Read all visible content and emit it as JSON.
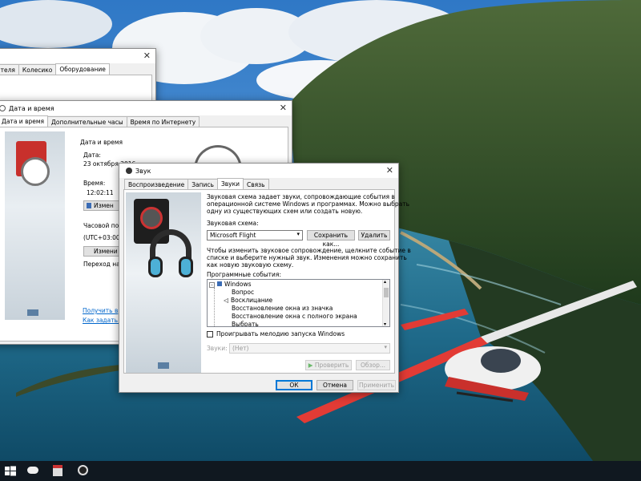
{
  "window1": {
    "tabs": [
      "ателя",
      "Колесико",
      "Оборудование"
    ]
  },
  "window2": {
    "title": "Дата и время",
    "tabs": [
      "Дата и время",
      "Дополнительные часы",
      "Время по Интернету"
    ],
    "date_group_label": "Дата и время",
    "date_label": "Дата:",
    "date_value": "23 октября 2016",
    "time_label": "Время:",
    "time_value": "12:02:11",
    "change_datetime_btn": "Измен",
    "timezone_label": "Часовой по",
    "timezone_value": "(UTC+03:00",
    "change_tz_btn": "Измени",
    "dst_text": "Переход на",
    "link1": "Получить в",
    "link2": "Как задать в"
  },
  "sound": {
    "title": "Звук",
    "tabs": [
      "Воспроизведение",
      "Запись",
      "Звуки",
      "Связь"
    ],
    "description": "Звуковая схема задает звуки, сопровождающие события в операционной системе Windows и программах. Можно выбрать одну из существующих схем или создать новую.",
    "description_lines": [
      "Звуковая схема задает звуки, сопровождающие события в",
      "операционной системе Windows и программах. Можно выбрать",
      "одну из существующих схем или создать новую."
    ],
    "scheme_label": "Звуковая схема:",
    "scheme_value": "Microsoft Flight",
    "save_as_btn": "Сохранить как...",
    "delete_btn": "Удалить",
    "instruction_lines": [
      "Чтобы изменить звуковое сопровождение, щелкните событие в",
      "списке и выберите нужный звук. Изменения можно сохранить",
      "как новую звуковую схему."
    ],
    "events_label": "Программные события:",
    "events_root": "Windows",
    "events": [
      "Вопрос",
      "Восклицание",
      "Восстановление окна из значка",
      "Восстановление окна с полного экрана",
      "Выбрать"
    ],
    "startup_checkbox": "Проигрывать мелодию запуска Windows",
    "sounds_label": "Звуки:",
    "sounds_value": "(Нет)",
    "test_btn": "Проверить",
    "browse_btn": "Обзор...",
    "ok_btn": "ОК",
    "cancel_btn": "Отмена",
    "apply_btn": "Применить"
  },
  "colors": {
    "accent": "#0078d7",
    "taskbar": "#101820",
    "link": "#0066cc"
  }
}
